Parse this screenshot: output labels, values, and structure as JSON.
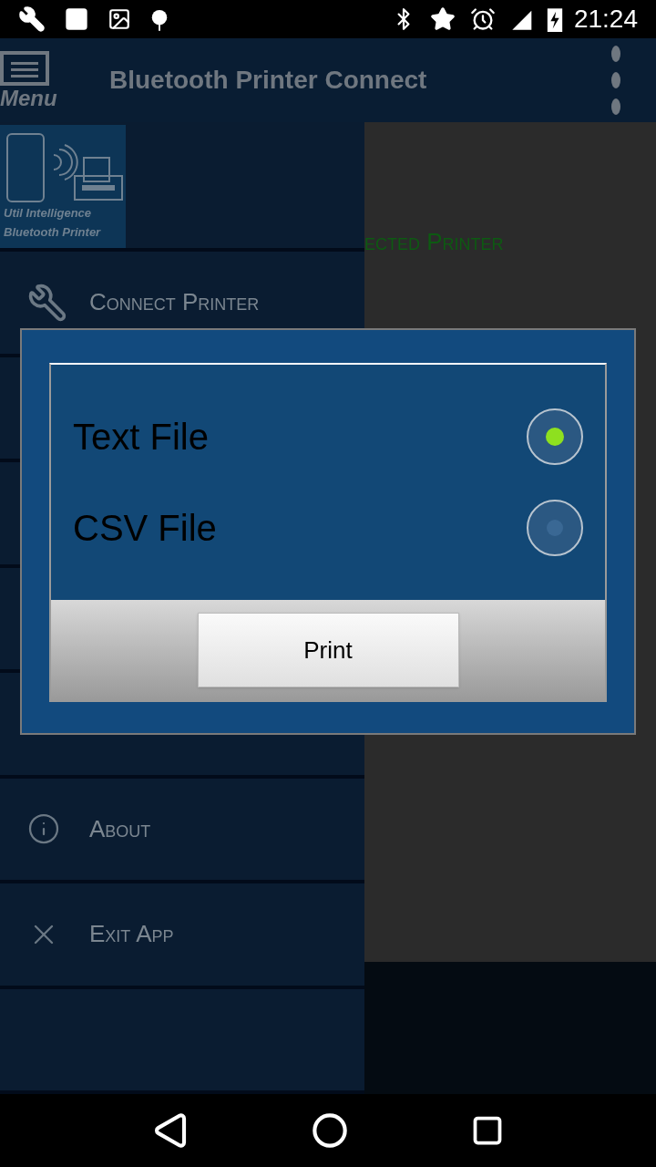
{
  "status_bar": {
    "time": "21:24"
  },
  "app_bar": {
    "menu_label": "Menu",
    "title": "Bluetooth Printer Connect"
  },
  "drawer": {
    "logo_lines": [
      "Util Intelligence",
      "Bluetooth Printer"
    ],
    "items": [
      {
        "label": "Connect Printer",
        "kind": "wrench"
      },
      {
        "kind": "hidden"
      },
      {
        "kind": "hidden"
      },
      {
        "kind": "hidden"
      },
      {
        "kind": "hidden"
      },
      {
        "label": "About",
        "kind": "info"
      },
      {
        "label": "Exit App",
        "kind": "close"
      },
      {
        "kind": "hidden"
      }
    ]
  },
  "content": {
    "status_text": "ected Printer"
  },
  "dialog": {
    "options": [
      {
        "label": "Text File",
        "selected": true
      },
      {
        "label": "CSV File",
        "selected": false
      }
    ],
    "button": "Print"
  }
}
